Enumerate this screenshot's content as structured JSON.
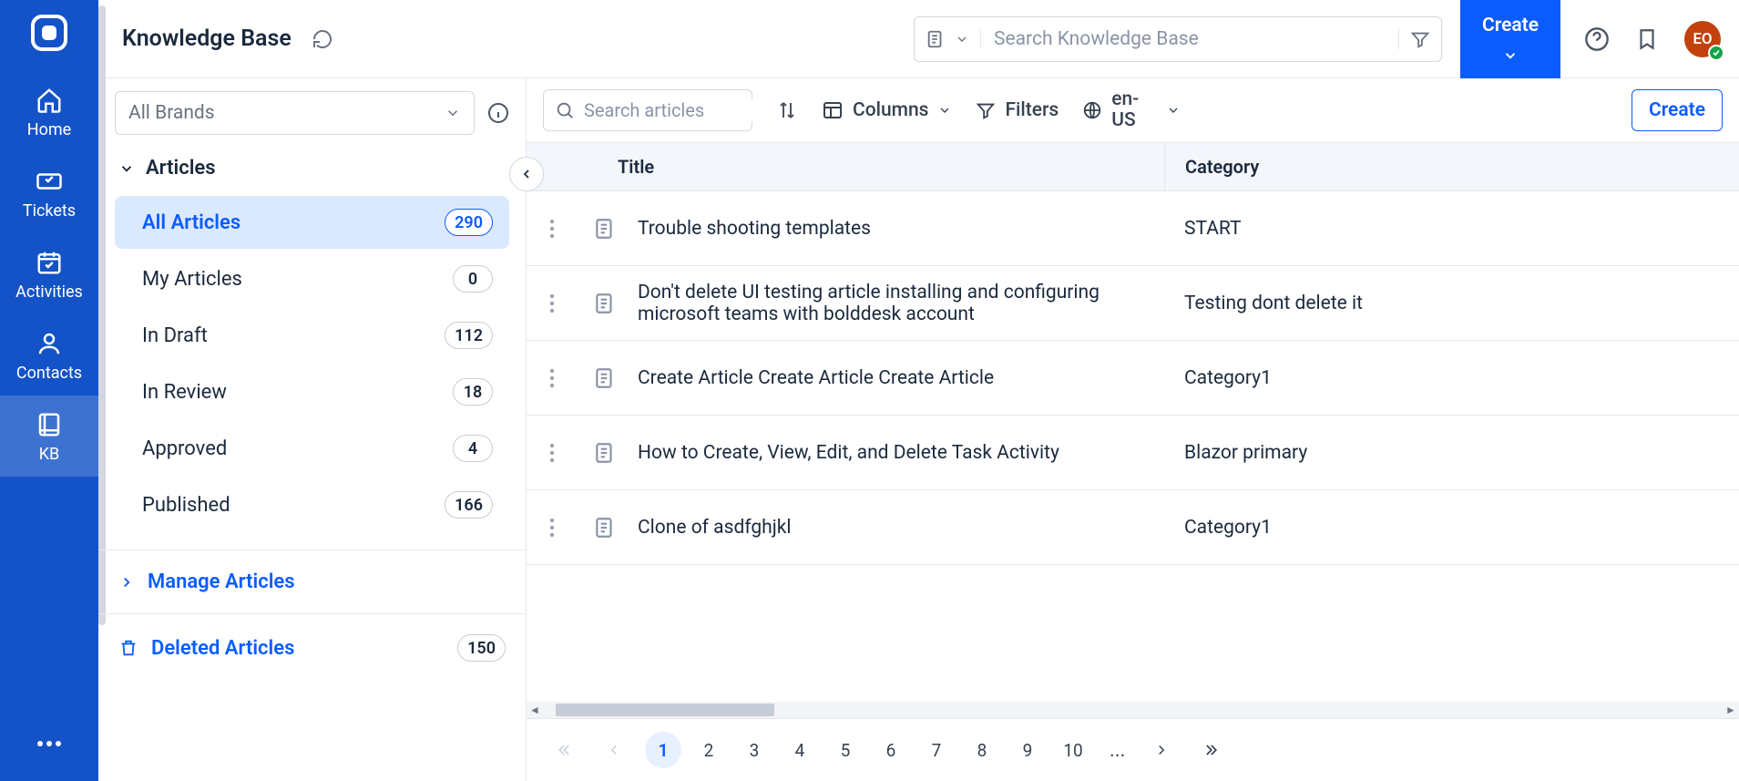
{
  "nav": {
    "items": [
      {
        "label": "Home"
      },
      {
        "label": "Tickets"
      },
      {
        "label": "Activities"
      },
      {
        "label": "Contacts"
      },
      {
        "label": "KB"
      }
    ]
  },
  "header": {
    "title": "Knowledge Base",
    "search_placeholder": "Search Knowledge Base",
    "create_label": "Create",
    "avatar_initials": "EO"
  },
  "sidebar": {
    "brand_placeholder": "All Brands",
    "section_label": "Articles",
    "items": [
      {
        "label": "All Articles",
        "count": "290",
        "selected": true
      },
      {
        "label": "My Articles",
        "count": "0",
        "selected": false
      },
      {
        "label": "In Draft",
        "count": "112",
        "selected": false
      },
      {
        "label": "In Review",
        "count": "18",
        "selected": false
      },
      {
        "label": "Approved",
        "count": "4",
        "selected": false
      },
      {
        "label": "Published",
        "count": "166",
        "selected": false
      }
    ],
    "manage_label": "Manage Articles",
    "deleted_label": "Deleted Articles",
    "deleted_count": "150"
  },
  "toolbar": {
    "search_placeholder": "Search articles",
    "columns_label": "Columns",
    "filters_label": "Filters",
    "locale_label": "en-US",
    "create_label": "Create"
  },
  "table": {
    "headers": {
      "title": "Title",
      "category": "Category"
    },
    "rows": [
      {
        "title": "Trouble shooting templates",
        "category": "START"
      },
      {
        "title": "Don't delete UI testing article  installing and configuring microsoft teams with bolddesk account",
        "category": "Testing dont delete it"
      },
      {
        "title": "Create Article Create Article Create Article",
        "category": "Category1"
      },
      {
        "title": "How to Create, View, Edit, and Delete Task Activity",
        "category": "Blazor primary"
      },
      {
        "title": "Clone of asdfghjkl",
        "category": "Category1"
      }
    ]
  },
  "pager": {
    "pages": [
      "1",
      "2",
      "3",
      "4",
      "5",
      "6",
      "7",
      "8",
      "9",
      "10"
    ],
    "current": "1"
  }
}
